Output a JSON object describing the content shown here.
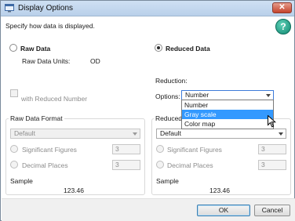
{
  "window": {
    "title": "Display Options"
  },
  "help": {
    "label": "?"
  },
  "instruction": "Specify how data is displayed.",
  "raw_data": {
    "label": "Raw Data",
    "units_label": "Raw Data Units:",
    "units_value": "OD",
    "with_reduced_label": "with Reduced Number"
  },
  "reduced_data": {
    "label": "Reduced Data",
    "reduction_label": "Reduction:",
    "options_label": "Options:",
    "options_selected": "Number",
    "dropdown": [
      "Number",
      "Gray scale",
      "Color map"
    ],
    "highlighted": "Gray scale"
  },
  "raw_format": {
    "title": "Raw Data Format",
    "select": "Default",
    "sig_label": "Significant Figures",
    "sig_value": "3",
    "dec_label": "Decimal Places",
    "dec_value": "3",
    "sample_label": "Sample",
    "sample_value": "123.46"
  },
  "reduced_format": {
    "title": "Reduced",
    "select": "Default",
    "sig_label": "Significant Figures",
    "sig_value": "3",
    "dec_label": "Decimal Places",
    "dec_value": "3",
    "sample_label": "Sample",
    "sample_value": "123.46"
  },
  "buttons": {
    "ok": "OK",
    "cancel": "Cancel"
  },
  "icons": {
    "close": "close-icon",
    "help": "help-icon",
    "app": "window-icon",
    "cursor": "mouse-pointer-icon"
  },
  "colors": {
    "highlight": "#3399ff",
    "help": "#0f8770",
    "close": "#c5432c"
  }
}
